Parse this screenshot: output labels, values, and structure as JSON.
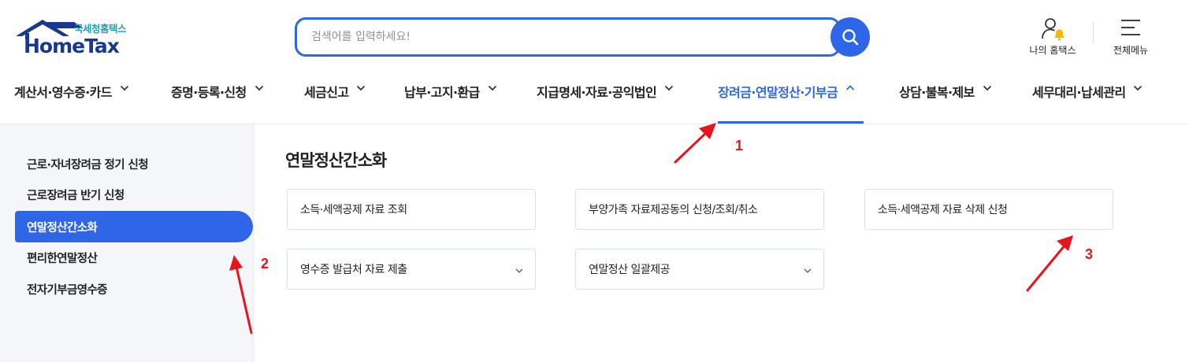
{
  "logo": {
    "sub": "국세청홈택스",
    "main": "HomeTax"
  },
  "search": {
    "placeholder": "검색어를 입력하세요!"
  },
  "header_links": {
    "my_hometax": "나의 홈택스",
    "all_menu": "전체메뉴"
  },
  "nav": {
    "items": [
      {
        "label": "계산서·영수증·카드"
      },
      {
        "label": "증명·등록·신청"
      },
      {
        "label": "세금신고"
      },
      {
        "label": "납부·고지·환급"
      },
      {
        "label": "지급명세·자료·공익법인"
      },
      {
        "label": "장려금·연말정산·기부금"
      },
      {
        "label": "상담·불복·제보"
      },
      {
        "label": "세무대리·납세관리"
      }
    ],
    "active_index": 5
  },
  "sidebar": {
    "items": [
      {
        "label": "근로·자녀장려금 정기 신청"
      },
      {
        "label": "근로장려금 반기 신청"
      },
      {
        "label": "연말정산간소화"
      },
      {
        "label": "편리한연말정산"
      },
      {
        "label": "전자기부금영수증"
      }
    ],
    "active_index": 2
  },
  "main": {
    "title": "연말정산간소화",
    "cards": [
      {
        "label": "소득·세액공제 자료 조회",
        "expandable": false
      },
      {
        "label": "부양가족 자료제공동의 신청/조회/취소",
        "expandable": false
      },
      {
        "label": "소득·세액공제 자료 삭제 신청",
        "expandable": false
      },
      {
        "label": "영수증 발급처 자료 제출",
        "expandable": true
      },
      {
        "label": "연말정산 일괄제공",
        "expandable": true
      }
    ]
  },
  "annotations": {
    "labels": [
      "1",
      "2",
      "3"
    ],
    "color": "#e8141c"
  },
  "colors": {
    "accent": "#2f66e8",
    "logo_navy": "#18388f",
    "logo_teal": "#1aa3b0",
    "bell": "#f5b800"
  },
  "icons": {
    "search": "search-icon",
    "my_hometax": "user-bell-icon",
    "all_menu": "hamburger-icon",
    "chevron": "chevron-down-icon",
    "chevron_active": "chevron-up-icon"
  }
}
